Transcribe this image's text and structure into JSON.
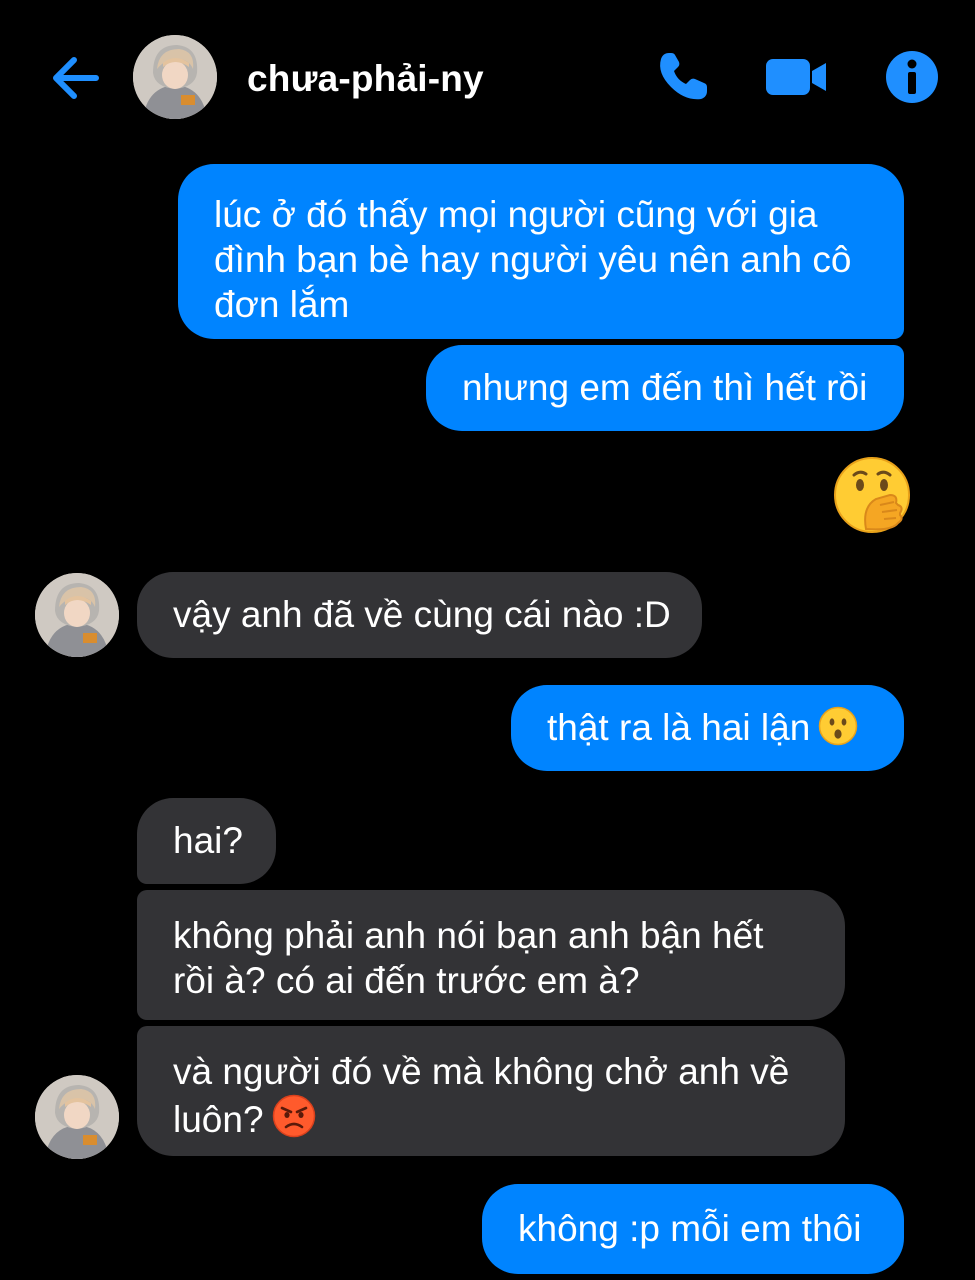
{
  "header": {
    "contact_name": "chưa-phải-ny",
    "back_icon": "arrow-left-icon",
    "phone_icon": "phone-icon",
    "video_icon": "video-camera-icon",
    "info_icon": "info-icon",
    "accent_color": "#0084ff"
  },
  "colors": {
    "background": "#000000",
    "sent_bubble": "#0084ff",
    "received_bubble": "#333336",
    "text": "#ffffff"
  },
  "messages": [
    {
      "from": "me",
      "text": "lúc ở đó thấy mọi người cũng với gia đình bạn bè hay người yêu nên anh cô đơn lắm"
    },
    {
      "from": "me",
      "text": "nhưng em đến thì hết rồi"
    },
    {
      "from": "me",
      "emoji": "face-with-hand-over-mouth-emoji"
    },
    {
      "from": "them",
      "text": "vậy anh đã về cùng cái nào :D"
    },
    {
      "from": "me",
      "text": "thật ra là hai lận",
      "trailing_emoji": "hushed-face-emoji"
    },
    {
      "from": "them",
      "text": "hai?"
    },
    {
      "from": "them",
      "text": "không phải anh nói bạn anh bận hết rồi à? có ai đến trước em à?"
    },
    {
      "from": "them",
      "text": "và người đó về mà không chở anh về luôn?",
      "trailing_emoji": "angry-face-emoji"
    },
    {
      "from": "me",
      "text": "không :p mỗi em thôi"
    }
  ]
}
